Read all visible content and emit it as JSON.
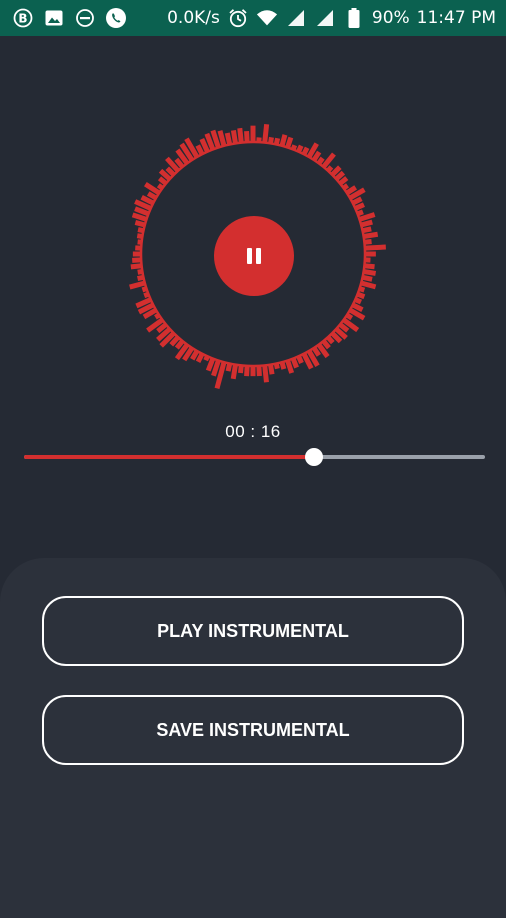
{
  "status_bar": {
    "network_speed": "0.0K/s",
    "battery": "90%",
    "time": "11:47 PM",
    "left_icons": [
      "bitcoin-icon",
      "image-icon",
      "do-not-disturb-icon",
      "whatsapp-icon"
    ],
    "right_icons": [
      "alarm-icon",
      "wifi-icon",
      "signal-icon",
      "signal-icon",
      "battery-icon"
    ],
    "background_color": "#0b6150"
  },
  "player": {
    "state": "playing",
    "control_icon": "pause-icon",
    "elapsed": "00 : 16",
    "progress_fraction": 0.63,
    "accent_color": "#d32f2f",
    "visualizer_color": "#d32f2f"
  },
  "actions": {
    "play_label": "PLAY INSTRUMENTAL",
    "save_label": "SAVE INSTRUMENTAL"
  }
}
